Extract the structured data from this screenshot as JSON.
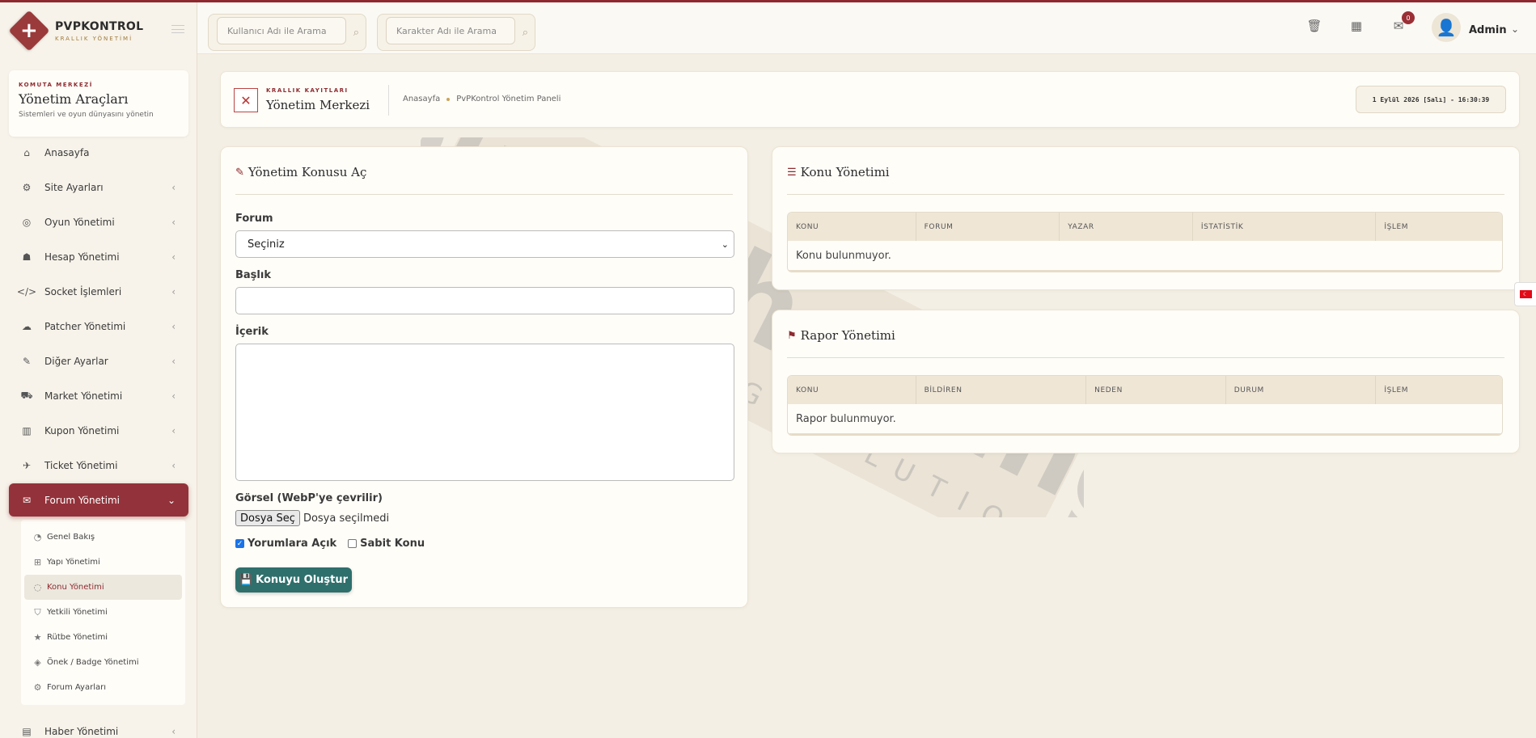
{
  "brand": {
    "name": "PVPKONTROL",
    "tagline": "KRALLIK YÖNETİMİ"
  },
  "sidebar": {
    "card": {
      "kicker": "KOMUTA MERKEZİ",
      "title": "Yönetim Araçları",
      "subtitle": "Sistemleri ve oyun dünyasını yönetin"
    },
    "items": [
      {
        "label": "Anasayfa",
        "icon": "home-icon",
        "glyph": "⌂"
      },
      {
        "label": "Site Ayarları",
        "icon": "gear-icon",
        "glyph": "⚙"
      },
      {
        "label": "Oyun Yönetimi",
        "icon": "gamepad-icon",
        "glyph": "◎"
      },
      {
        "label": "Hesap Yönetimi",
        "icon": "users-icon",
        "glyph": "☗"
      },
      {
        "label": "Socket İşlemleri",
        "icon": "code-icon",
        "glyph": "</>"
      },
      {
        "label": "Patcher Yönetimi",
        "icon": "cloud-upload-icon",
        "glyph": "☁"
      },
      {
        "label": "Diğer Ayarlar",
        "icon": "wrench-icon",
        "glyph": "✎"
      },
      {
        "label": "Market Yönetimi",
        "icon": "cart-icon",
        "glyph": "⛟"
      },
      {
        "label": "Kupon Yönetimi",
        "icon": "barcode-icon",
        "glyph": "▥"
      },
      {
        "label": "Ticket Yönetimi",
        "icon": "ticket-icon",
        "glyph": "✈"
      },
      {
        "label": "Forum Yönetimi",
        "icon": "comments-icon",
        "glyph": "✉"
      }
    ],
    "sub_items": [
      {
        "label": "Genel Bakış",
        "icon": "dashboard-icon",
        "glyph": "◔"
      },
      {
        "label": "Yapı Yönetimi",
        "icon": "sitemap-icon",
        "glyph": "⊞"
      },
      {
        "label": "Konu Yönetimi",
        "icon": "comment-icon",
        "glyph": "◌"
      },
      {
        "label": "Yetkili Yönetimi",
        "icon": "shield-icon",
        "glyph": "⛉"
      },
      {
        "label": "Rütbe Yönetimi",
        "icon": "star-icon",
        "glyph": "★"
      },
      {
        "label": "Önek / Badge Yönetimi",
        "icon": "tags-icon",
        "glyph": "◈"
      },
      {
        "label": "Forum Ayarları",
        "icon": "cogs-icon",
        "glyph": "⚙"
      }
    ],
    "after_items": [
      {
        "label": "Haber Yönetimi",
        "icon": "newspaper-icon",
        "glyph": "▤"
      }
    ]
  },
  "header": {
    "search_user_placeholder": "Kullanıcı Adı ile Arama",
    "search_char_placeholder": "Karakter Adı ile Arama",
    "mail_count": "0",
    "user_name": "Admin"
  },
  "page": {
    "kicker": "KRALLIK KAYITLARI",
    "title": "Yönetim Merkezi",
    "breadcrumb": [
      "Anasayfa",
      "PvPKontrol Yönetim Paneli"
    ],
    "datetime": "1 Eylül 2026 [Salı] - 16:30:39"
  },
  "form": {
    "title": "Yönetim Konusu Aç",
    "forum_label": "Forum",
    "forum_selected": "Seçiniz",
    "title_label": "Başlık",
    "content_label": "İçerik",
    "image_label": "Görsel (WebP'ye çevrilir)",
    "file_button": "Dosya Seç",
    "file_status": "Dosya seçilmedi",
    "comments_open": "Yorumlara Açık",
    "sticky": "Sabit Konu",
    "submit": "Konuyu Oluştur"
  },
  "topics": {
    "title": "Konu Yönetimi",
    "columns": [
      "KONU",
      "FORUM",
      "YAZAR",
      "İSTATİSTİK",
      "İŞLEM"
    ],
    "empty": "Konu bulunmuyor."
  },
  "reports": {
    "title": "Rapor Yönetimi",
    "columns": [
      "KONU",
      "BİLDİREN",
      "NEDEN",
      "DURUM",
      "İŞLEM"
    ],
    "empty": "Rapor bulunmuyor."
  },
  "watermark": {
    "brand": "buyukhosting",
    "slogan": "LARGE HOSTING SOLUTIONS"
  },
  "colors": {
    "accent": "#8e2a2f",
    "teal": "#2f6f6c",
    "background": "#f4efe4"
  }
}
